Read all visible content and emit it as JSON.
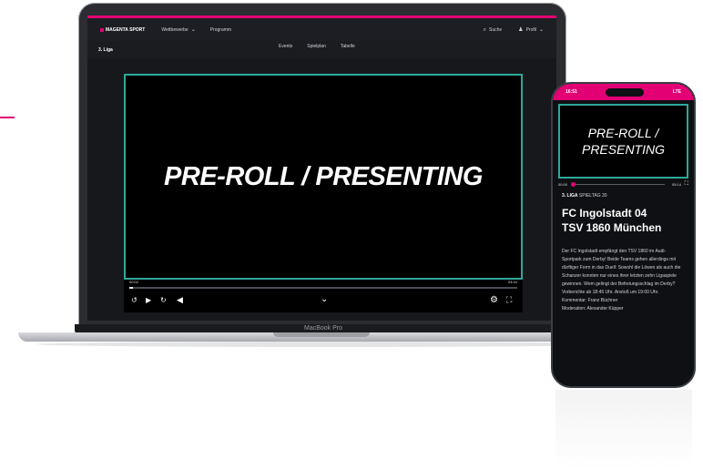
{
  "colors": {
    "brand": "#e20074",
    "frame": "#2ea89a",
    "screen_bg": "#16181c"
  },
  "laptop": {
    "device_label": "MacBook Pro",
    "brand": "MAGENTA SPORT",
    "nav": [
      {
        "label": "Wettbewerbe",
        "icon": "chevron-down-icon",
        "glyph": "⌄"
      },
      {
        "label": "Programm"
      }
    ],
    "search_label": "Suche",
    "profile_label": "Profil",
    "league": "3. Liga",
    "tabs": [
      "Events",
      "Spielplan",
      "Tabelle"
    ],
    "player": {
      "title": "PRE-ROLL / PRESENTING",
      "time_current": "00:02",
      "time_total": "04:44",
      "progress": 0.01,
      "controls": {
        "rewind_icon": "replay-icon",
        "play_icon": "play-icon",
        "forward_icon": "forward-icon",
        "volume_icon": "volume-icon",
        "chevron_icon": "chevron-down-icon",
        "settings_icon": "gear-icon",
        "fullscreen_icon": "fullscreen-icon"
      }
    }
  },
  "phone": {
    "clock": "16:51",
    "network": "LTE",
    "player": {
      "title_line1": "PRE-ROLL /",
      "title_line2": "PRESENTING",
      "time_current": "00:00",
      "time_total": "05:14",
      "progress": 0.02
    },
    "league": "3. LIGA",
    "matchday": "SPIELTAG 30",
    "team_home": "FC Ingolstadt 04",
    "team_away": "TSV 1860 München",
    "description": "Der FC Ingolstadt empfängt den TSV 1860 im Audi-Sportpark zum Derby! Beide Teams gehen allerdings mit dürftiger Form in das Duell: Sowohl die Löwen als auch die Schanzer konnten nur eines ihrer letzten zehn Ligaspiele gewinnen. Wem gelingt der Befreiungsschlag im Derby?",
    "schedule": "Vorberichte ab 18:45 Uhr. Anstoß um 19:00 Uhr.",
    "commentator": "Kommentar: Franz Büchner",
    "moderator": "Moderation: Alexander Küpper"
  }
}
